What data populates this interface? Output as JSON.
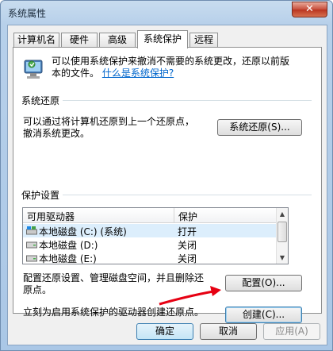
{
  "window": {
    "title": "系统属性",
    "close_glyph": "✕"
  },
  "tabs": [
    {
      "label": "计算机名"
    },
    {
      "label": "硬件"
    },
    {
      "label": "高级"
    },
    {
      "label": "系统保护",
      "active": true
    },
    {
      "label": "远程"
    }
  ],
  "intro": {
    "line1": "可以使用系统保护来撤消不需要的系统更改，还原以前版",
    "line2_prefix": "本的文件。",
    "link": "什么是系统保护?"
  },
  "restore": {
    "title": "系统还原",
    "desc_line1": "可以通过将计算机还原到上一个还原点，",
    "desc_line2": "撤消系统更改。",
    "button": "系统还原(S)..."
  },
  "protection": {
    "title": "保护设置",
    "columns": [
      "可用驱动器",
      "保护"
    ],
    "rows": [
      {
        "drive": "本地磁盘 (C:) (系统)",
        "status": "打开",
        "icon": "system-drive-icon"
      },
      {
        "drive": "本地磁盘 (D:)",
        "status": "关闭",
        "icon": "hard-drive-icon"
      },
      {
        "drive": "本地磁盘 (E:)",
        "status": "关闭",
        "icon": "hard-drive-icon"
      }
    ],
    "config_line1": "配置还原设置、管理磁盘空间，并且删除还",
    "config_line2": "原点。",
    "config_button": "配置(O)...",
    "create_text": "立刻为启用系统保护的驱动器创建还原点。",
    "create_button": "创建(C)..."
  },
  "footer": {
    "ok": "确定",
    "cancel": "取消",
    "apply": "应用(A)"
  },
  "colors": {
    "accent": "#3c7fb1",
    "link": "#0066cc",
    "annotation_arrow": "#e60012"
  }
}
